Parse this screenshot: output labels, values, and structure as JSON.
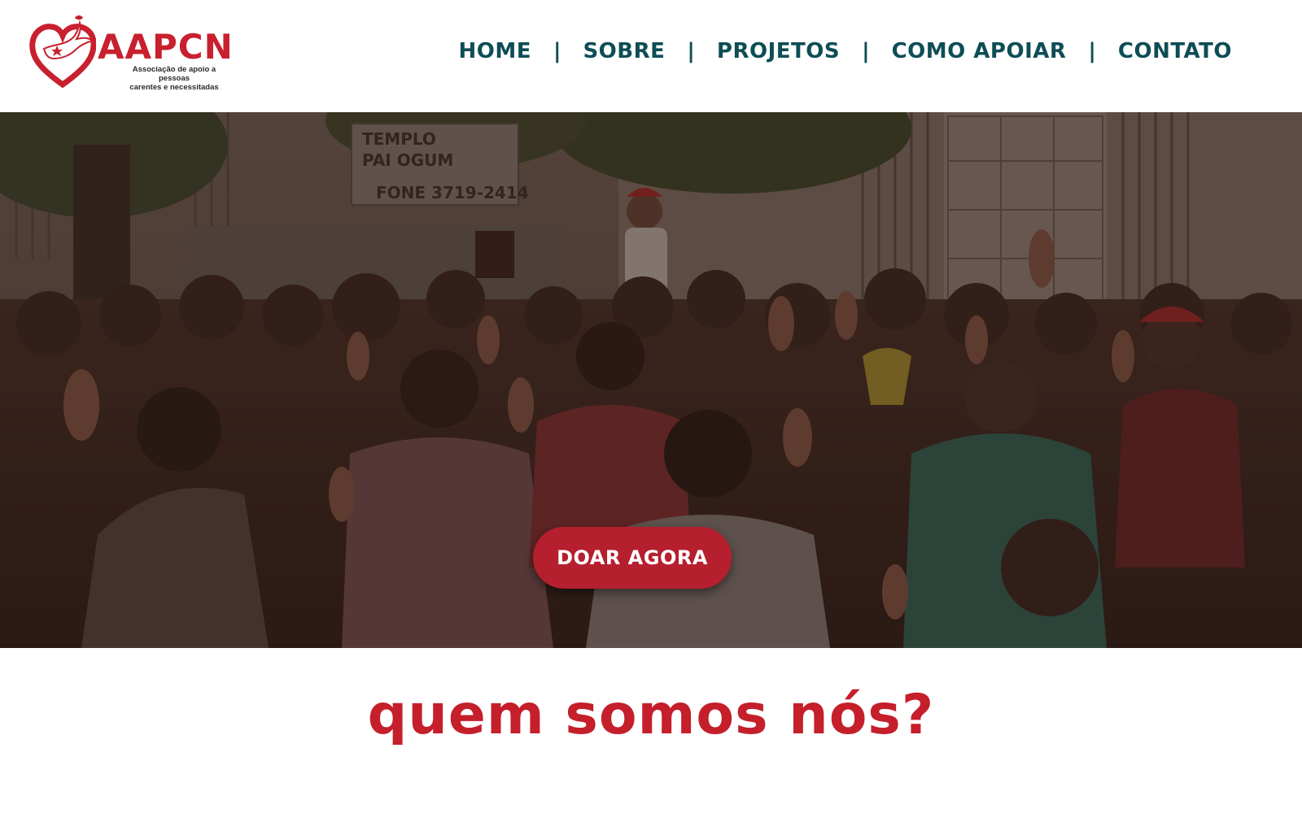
{
  "brand": {
    "name": "AAPCN",
    "tagline_line1": "Associação de apoio a pessoas",
    "tagline_line2": "carentes e necessitadas",
    "color": "#c8202e"
  },
  "nav": {
    "items": [
      {
        "label": "HOME"
      },
      {
        "label": "SOBRE"
      },
      {
        "label": "PROJETOS"
      },
      {
        "label": "COMO APOIAR"
      },
      {
        "label": "CONTATO"
      }
    ],
    "separator": "|",
    "color": "#0e4d55"
  },
  "hero": {
    "sign_line1": "TEMPLO",
    "sign_line2": "PAI OGUM",
    "sign_phone": "FONE 3719-2414",
    "cta_label": "DOAR AGORA",
    "cta_color": "#b51f2e"
  },
  "about": {
    "title": "quem somos nós?",
    "color": "#c41f2a"
  }
}
